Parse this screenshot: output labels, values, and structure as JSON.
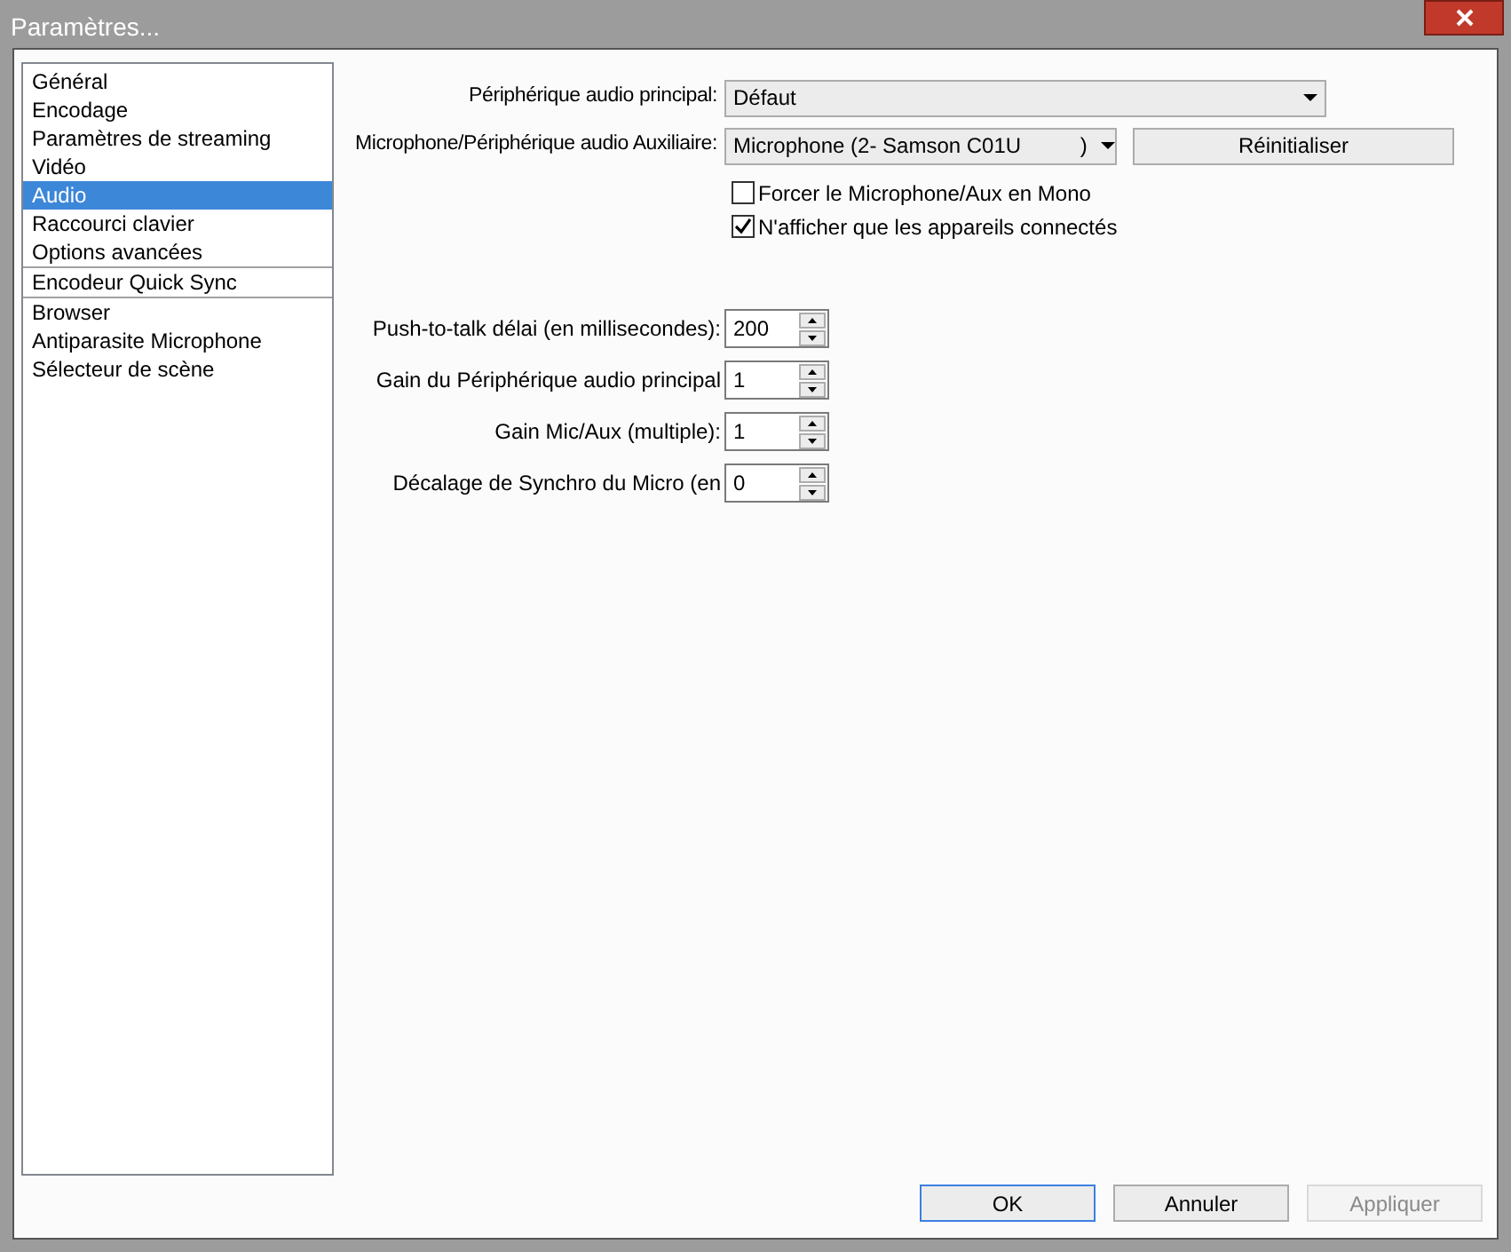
{
  "window": {
    "title": "Paramètres..."
  },
  "sidebar": {
    "groups": [
      [
        {
          "label": "Général",
          "selected": false
        },
        {
          "label": "Encodage",
          "selected": false
        },
        {
          "label": "Paramètres de streaming",
          "selected": false
        },
        {
          "label": "Vidéo",
          "selected": false
        },
        {
          "label": "Audio",
          "selected": true
        },
        {
          "label": "Raccourci clavier",
          "selected": false
        },
        {
          "label": "Options avancées",
          "selected": false
        }
      ],
      [
        {
          "label": "Encodeur Quick Sync",
          "selected": false
        }
      ],
      [
        {
          "label": "Browser",
          "selected": false
        },
        {
          "label": "Antiparasite Microphone",
          "selected": false
        },
        {
          "label": "Sélecteur de scène",
          "selected": false
        }
      ]
    ]
  },
  "devices": [
    {
      "label": "Périphérique audio principal:",
      "value": "Défaut"
    },
    {
      "label": "Microphone/Périphérique audio Auxiliaire:",
      "value": "Microphone (2- Samson C01U          )",
      "button": "Réinitialiser"
    }
  ],
  "checkboxes": [
    {
      "label": "Forcer le Microphone/Aux en Mono",
      "checked": false
    },
    {
      "label": "N'afficher que les appareils connectés",
      "checked": true
    }
  ],
  "spinners": [
    {
      "label": "Push-to-talk délai (en millisecondes):",
      "value": "200"
    },
    {
      "label": "Gain du Périphérique audio principal",
      "value": "1"
    },
    {
      "label": "Gain Mic/Aux (multiple):",
      "value": "1"
    },
    {
      "label": "Décalage de Synchro du Micro (en",
      "value": "0"
    }
  ],
  "buttons": [
    {
      "label": "OK",
      "default": true,
      "disabled": false
    },
    {
      "label": "Annuler",
      "default": false,
      "disabled": false
    },
    {
      "label": "Appliquer",
      "default": false,
      "disabled": true
    }
  ]
}
